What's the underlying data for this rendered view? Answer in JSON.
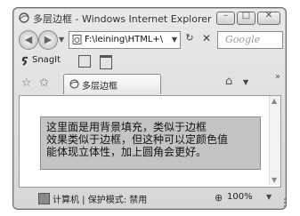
{
  "window": {
    "title": "多层边框 - Windows Internet Explorer",
    "minimize_glyph": "–",
    "maximize_glyph": "□",
    "close_glyph": "✕"
  },
  "nav": {
    "back_glyph": "◀",
    "forward_glyph": "▶",
    "address": "F:\\leining\\HTML+\\",
    "refresh_glyph": "↻",
    "stop_glyph": "✕",
    "search_placeholder": "Google"
  },
  "toolbar": {
    "snagit_label": "SnagIt"
  },
  "tabs": {
    "active_label": "多层边框",
    "home_glyph": "⌂",
    "more_glyph": "»"
  },
  "content": {
    "lines": [
      "这里面是用背景填充，类似于边框",
      "效果类似于边框，但这种可以定颜色值",
      "能体现立体性，加上圆角会更好。"
    ],
    "box_color": "#c4c4c4",
    "border_color": "#8c8c8c"
  },
  "status": {
    "zone": "计算机 | 保护模式: 禁用",
    "zoom": "100%"
  },
  "icons": [
    "ie-page-icon",
    "back-icon",
    "forward-icon",
    "refresh-icon",
    "stop-icon",
    "snagit-icon",
    "favorites-star-icon",
    "add-favorites-icon",
    "home-icon",
    "computer-icon",
    "zoom-icon"
  ]
}
